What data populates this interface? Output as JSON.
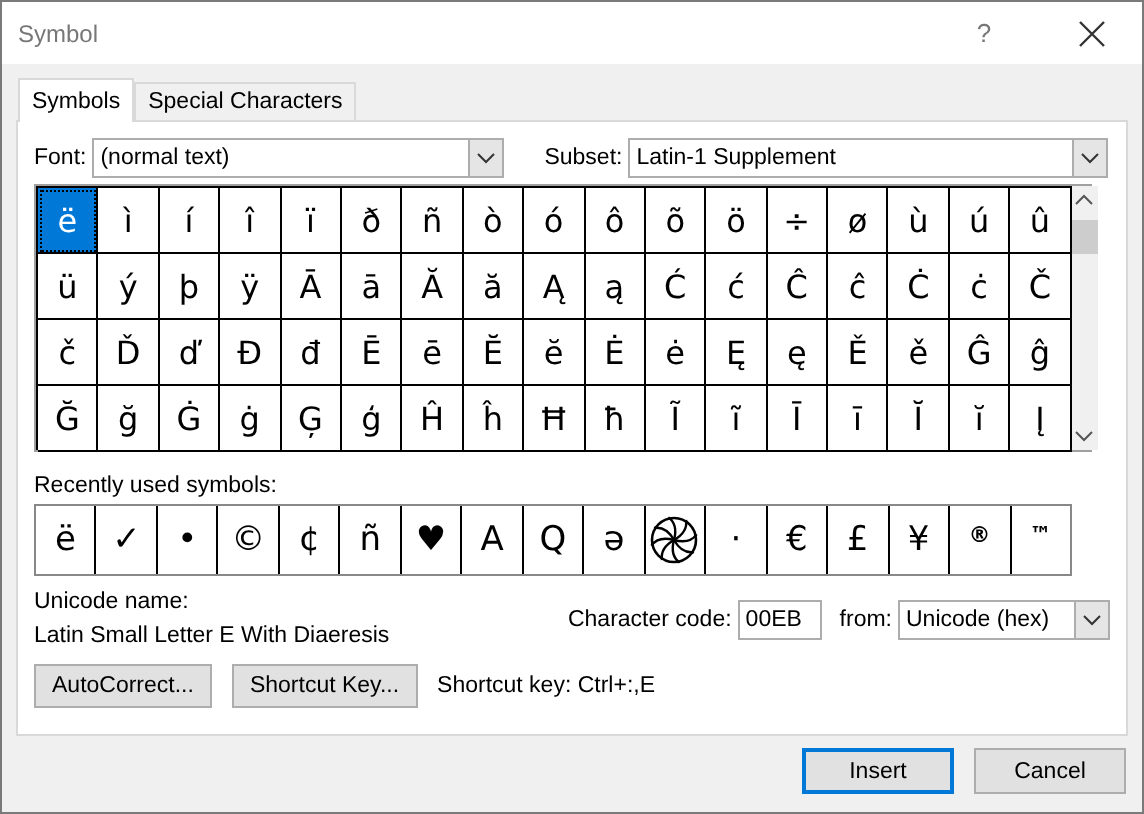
{
  "window": {
    "title": "Symbol",
    "help": "?"
  },
  "tabs": [
    {
      "label": "Symbols",
      "selected": true
    },
    {
      "label": "Special Characters",
      "selected": false
    }
  ],
  "font": {
    "label": "Font:",
    "value": "(normal text)"
  },
  "subset": {
    "label": "Subset:",
    "value": "Latin-1 Supplement"
  },
  "grid": [
    {
      "char": "ë",
      "selected": true
    },
    {
      "char": "ì",
      "selected": false
    },
    {
      "char": "í",
      "selected": false
    },
    {
      "char": "î",
      "selected": false
    },
    {
      "char": "ï",
      "selected": false
    },
    {
      "char": "ð",
      "selected": false
    },
    {
      "char": "ñ",
      "selected": false
    },
    {
      "char": "ò",
      "selected": false
    },
    {
      "char": "ó",
      "selected": false
    },
    {
      "char": "ô",
      "selected": false
    },
    {
      "char": "õ",
      "selected": false
    },
    {
      "char": "ö",
      "selected": false
    },
    {
      "char": "÷",
      "selected": false
    },
    {
      "char": "ø",
      "selected": false
    },
    {
      "char": "ù",
      "selected": false
    },
    {
      "char": "ú",
      "selected": false
    },
    {
      "char": "û",
      "selected": false
    },
    {
      "char": "ü",
      "selected": false
    },
    {
      "char": "ý",
      "selected": false
    },
    {
      "char": "þ",
      "selected": false
    },
    {
      "char": "ÿ",
      "selected": false
    },
    {
      "char": "Ā",
      "selected": false
    },
    {
      "char": "ā",
      "selected": false
    },
    {
      "char": "Ă",
      "selected": false
    },
    {
      "char": "ă",
      "selected": false
    },
    {
      "char": "Ą",
      "selected": false
    },
    {
      "char": "ą",
      "selected": false
    },
    {
      "char": "Ć",
      "selected": false
    },
    {
      "char": "ć",
      "selected": false
    },
    {
      "char": "Ĉ",
      "selected": false
    },
    {
      "char": "ĉ",
      "selected": false
    },
    {
      "char": "Ċ",
      "selected": false
    },
    {
      "char": "ċ",
      "selected": false
    },
    {
      "char": "Č",
      "selected": false
    },
    {
      "char": "č",
      "selected": false
    },
    {
      "char": "Ď",
      "selected": false
    },
    {
      "char": "ď",
      "selected": false
    },
    {
      "char": "Đ",
      "selected": false
    },
    {
      "char": "đ",
      "selected": false
    },
    {
      "char": "Ē",
      "selected": false
    },
    {
      "char": "ē",
      "selected": false
    },
    {
      "char": "Ĕ",
      "selected": false
    },
    {
      "char": "ĕ",
      "selected": false
    },
    {
      "char": "Ė",
      "selected": false
    },
    {
      "char": "ė",
      "selected": false
    },
    {
      "char": "Ę",
      "selected": false
    },
    {
      "char": "ę",
      "selected": false
    },
    {
      "char": "Ě",
      "selected": false
    },
    {
      "char": "ě",
      "selected": false
    },
    {
      "char": "Ĝ",
      "selected": false
    },
    {
      "char": "ĝ",
      "selected": false
    },
    {
      "char": "Ğ",
      "selected": false
    },
    {
      "char": "ğ",
      "selected": false
    },
    {
      "char": "Ġ",
      "selected": false
    },
    {
      "char": "ġ",
      "selected": false
    },
    {
      "char": "Ģ",
      "selected": false
    },
    {
      "char": "ģ",
      "selected": false
    },
    {
      "char": "Ĥ",
      "selected": false
    },
    {
      "char": "ĥ",
      "selected": false
    },
    {
      "char": "Ħ",
      "selected": false
    },
    {
      "char": "ħ",
      "selected": false
    },
    {
      "char": "Ĩ",
      "selected": false
    },
    {
      "char": "ĩ",
      "selected": false
    },
    {
      "char": "Ī",
      "selected": false
    },
    {
      "char": "ī",
      "selected": false
    },
    {
      "char": "Ĭ",
      "selected": false
    },
    {
      "char": "ĭ",
      "selected": false
    },
    {
      "char": "Į",
      "selected": false
    }
  ],
  "recent": {
    "label": "Recently used symbols:",
    "items": [
      {
        "kind": "char",
        "char": "ë"
      },
      {
        "kind": "char",
        "char": "✓"
      },
      {
        "kind": "char",
        "char": "•"
      },
      {
        "kind": "char",
        "char": "©"
      },
      {
        "kind": "char",
        "char": "¢"
      },
      {
        "kind": "char",
        "char": "ñ"
      },
      {
        "kind": "char",
        "char": "♥"
      },
      {
        "kind": "char",
        "char": "A"
      },
      {
        "kind": "char",
        "char": "Q"
      },
      {
        "kind": "char",
        "char": "ə"
      },
      {
        "kind": "spiral"
      },
      {
        "kind": "char",
        "char": "·"
      },
      {
        "kind": "char",
        "char": "€"
      },
      {
        "kind": "char",
        "char": "£"
      },
      {
        "kind": "char",
        "char": "¥"
      },
      {
        "kind": "small",
        "char": "®"
      },
      {
        "kind": "small",
        "char": "™"
      }
    ]
  },
  "unicode_name": {
    "label": "Unicode name:",
    "value": "Latin Small Letter E With Diaeresis"
  },
  "character_code": {
    "label": "Character code:",
    "value": "00EB"
  },
  "from": {
    "label": "from:",
    "value": "Unicode (hex)"
  },
  "buttons": [
    "AutoCorrect...",
    "Shortcut Key..."
  ],
  "shortcut_key": "Shortcut key: Ctrl+:,E",
  "actions": [
    {
      "label": "Insert",
      "default": true
    },
    {
      "label": "Cancel",
      "default": false
    }
  ]
}
